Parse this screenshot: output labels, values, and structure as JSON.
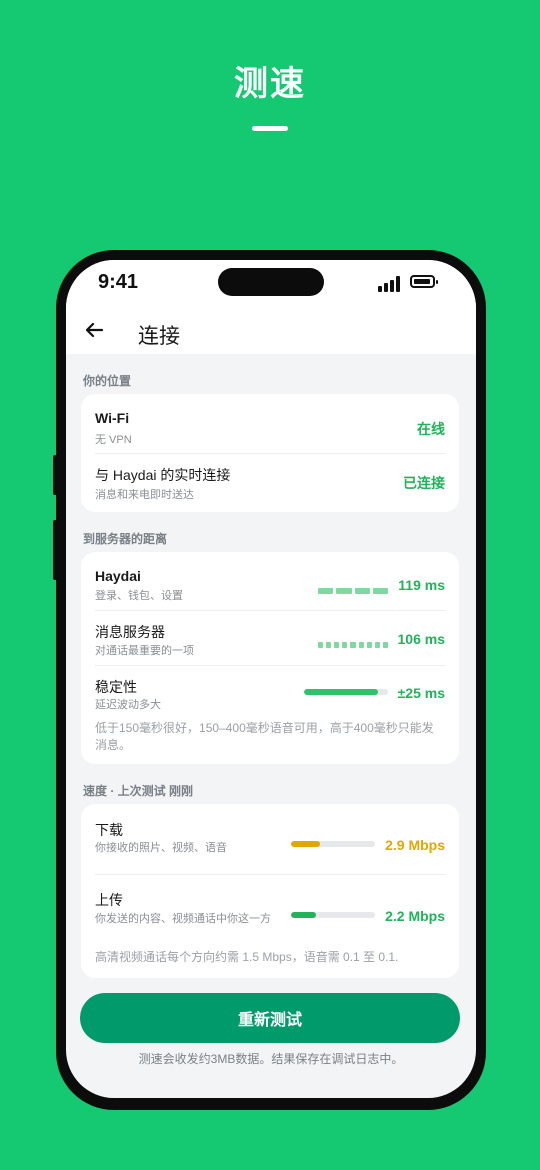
{
  "hero": {
    "title": "测速"
  },
  "status_bar": {
    "time": "9:41"
  },
  "nav": {
    "title": "连接"
  },
  "location": {
    "label": "你的位置",
    "rows": [
      {
        "title": "Wi-Fi",
        "subtitle": "无 VPN",
        "status": "在线"
      },
      {
        "title": "与 Haydai 的实时连接",
        "subtitle": "消息和来电即时送达",
        "status": "已连接"
      }
    ]
  },
  "distance": {
    "label": "到服务器的距离",
    "rows": [
      {
        "title": "Haydai",
        "subtitle": "登录、钱包、设置",
        "value": "119 ms",
        "segments": 4
      },
      {
        "title": "消息服务器",
        "subtitle": "对通话最重要的一项",
        "value": "106 ms",
        "segments": 9
      },
      {
        "title": "稳定性",
        "subtitle": "延迟波动多大",
        "value": "±25 ms",
        "level": 0.88
      }
    ],
    "note": "低于150毫秒很好，150–400毫秒语音可用，高于400毫秒只能发消息。"
  },
  "speed": {
    "label": "速度 · 上次测试 刚刚",
    "rows": [
      {
        "title": "下载",
        "subtitle": "你接收的照片、视频、语音",
        "value": "2.9 Mbps",
        "level": 0.35,
        "color": "#e0a800"
      },
      {
        "title": "上传",
        "subtitle": "你发送的内容、视频通话中你这一方",
        "value": "2.2 Mbps",
        "level": 0.3,
        "color": "#21b35a"
      }
    ],
    "note": "高清视频通话每个方向约需 1.5 Mbps，语音需 0.1 至 0.1."
  },
  "actions": {
    "retest_label": "重新测试"
  },
  "footer": {
    "note": "测速会收发约3MB数据。结果保存在调试日志中。"
  },
  "colors": {
    "brand": "#15c872",
    "button": "#019a6b",
    "ok": "#21b35a",
    "warn": "#e0a800"
  }
}
